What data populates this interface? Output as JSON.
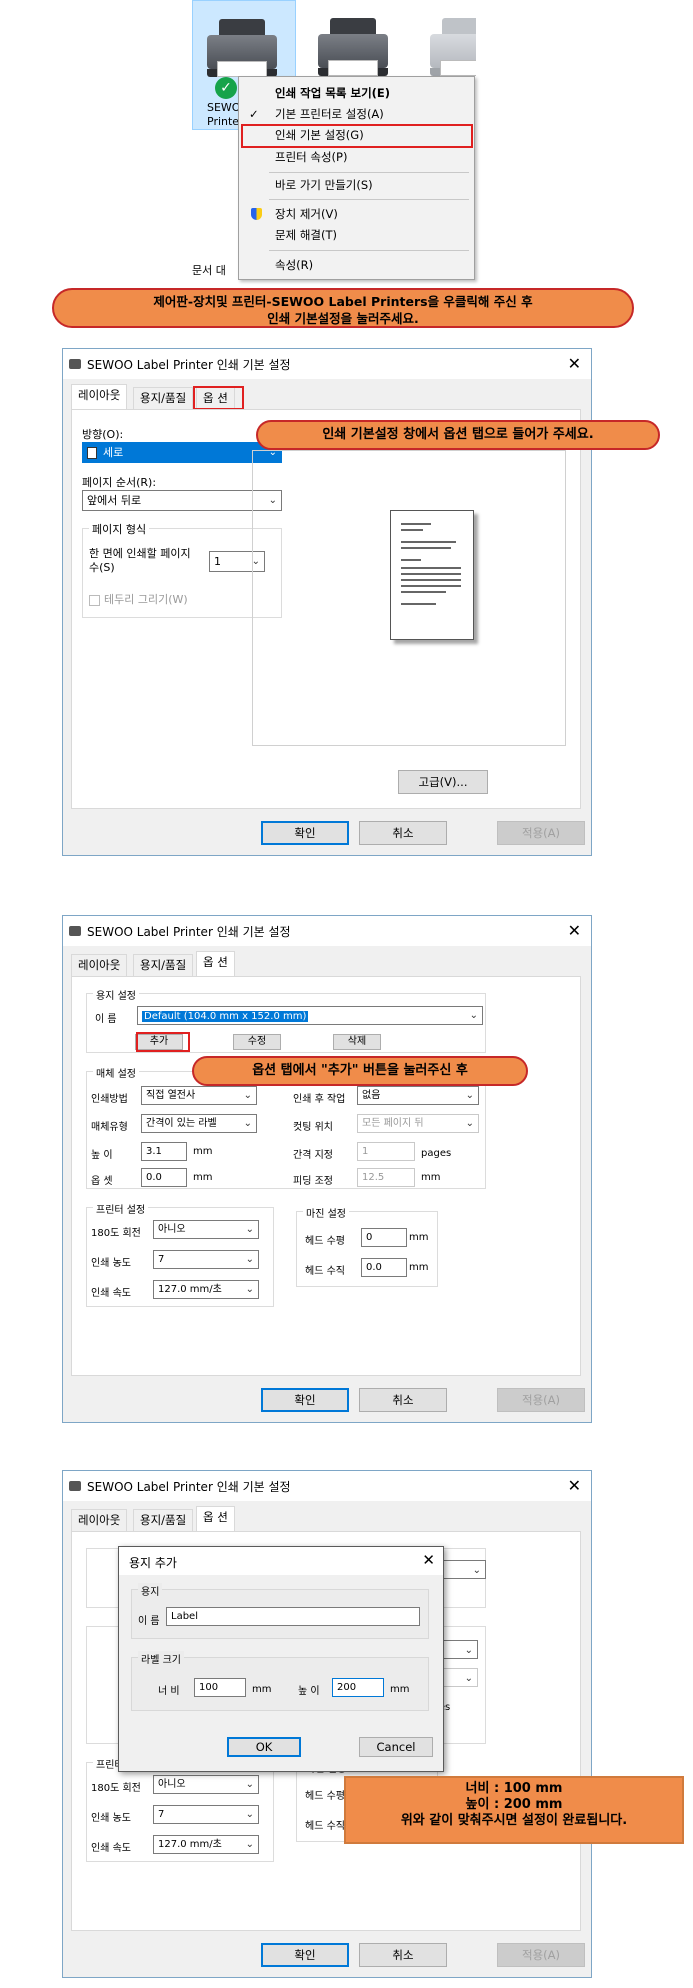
{
  "printers": [
    {
      "label": "SEWOO",
      "label2": "Printer"
    },
    {
      "label": ""
    },
    {
      "label": ""
    }
  ],
  "left_frag": "문서 대",
  "context_menu": [
    {
      "label": "인쇄 작업 목록 보기(E)",
      "bold": true
    },
    {
      "label": "기본 프린터로 설정(A)",
      "check": "✓"
    },
    {
      "label": "인쇄 기본 설정(G)"
    },
    {
      "label": "프린터 속성(P)"
    },
    {
      "label": "바로 가기 만들기(S)"
    },
    {
      "label": "장치 제거(V)"
    },
    {
      "label": "문제 해결(T)"
    },
    {
      "label": "속성(R)"
    }
  ],
  "callouts": {
    "c1": "제어판-장치및 프린터-SEWOO Label Printers을 우클릭해 주신 후",
    "c1b": "인쇄 기본설정을 눌러주세요.",
    "c2": "인쇄 기본설정 창에서 옵션 탭으로 들어가 주세요.",
    "c3": "옵션 탭에서 \"추가\" 버튼을 눌러주신 후",
    "c4a": "너비 : 100 mm",
    "c4b": "높이 : 200 mm",
    "c4c": "위와 같이 맞춰주시면 설정이 완료됩니다."
  },
  "dialog": {
    "title": "SEWOO Label Printer 인쇄 기본 설정",
    "tabs": [
      "레이아웃",
      "용지/품질",
      "옵 션"
    ],
    "ok": "확인",
    "cancel": "취소",
    "apply": "적용(A)"
  },
  "layout": {
    "orientation_label": "방향(O):",
    "orientation_value": "세로",
    "page_order_label": "페이지 순서(R):",
    "page_order_value": "앞에서 뒤로",
    "page_format_label": "페이지 형식",
    "pages_per_sheet_label": "한 면에 인쇄할 페이지 수(S)",
    "pages_per_sheet_value": "1",
    "draw_borders_label": "테두리 그리기(W)",
    "advanced": "고급(V)..."
  },
  "options": {
    "paper_group": "용지 설정",
    "name_label": "이 름",
    "name_value": "Default (104.0 mm x 152.0 mm)",
    "add": "추가",
    "edit": "수정",
    "delete": "삭제",
    "media_group": "매체 설정",
    "print_method_label": "인쇄방법",
    "print_method_value": "직접 열전사",
    "media_type_label": "매체유형",
    "media_type_value": "간격이 있는 라벨",
    "height_label": "높 이",
    "height_value": "3.1",
    "height_unit": "mm",
    "offset_label": "옵 셋",
    "offset_value": "0.0",
    "offset_unit": "mm",
    "post_print_label": "인쇄 후 작업",
    "post_print_value": "없음",
    "cut_pos_label": "컷팅 위치",
    "cut_pos_value": "모든 페이지 뒤",
    "interval_label": "간격 지정",
    "interval_value": "1",
    "interval_unit": "pages",
    "feed_label": "피딩 조정",
    "feed_value": "12.5",
    "feed_unit": "mm",
    "printer_group": "프린터 설정",
    "rotate_label": "180도 회전",
    "rotate_value": "아니오",
    "density_label": "인쇄 농도",
    "density_value": "7",
    "speed_label": "인쇄 속도",
    "speed_value": "127.0 mm/초",
    "margin_group": "마진 설정",
    "head_h_label": "헤드 수평",
    "head_h_value": "0",
    "head_h_unit": "mm",
    "head_v_label": "헤드 수직",
    "head_v_value": "0.0",
    "head_v_unit": "mm"
  },
  "add_paper": {
    "title": "용지 추가",
    "paper_group": "용지",
    "name_label": "이 름",
    "name_value": "Label",
    "size_group": "라벨 크기",
    "width_label": "너 비",
    "width_value": "100",
    "width_unit": "mm",
    "height_label": "높 이",
    "height_value": "200",
    "height_unit": "mm",
    "ok": "OK",
    "cancel": "Cancel",
    "trunc_pages": "pages"
  },
  "colors": {
    "callout": "#f08c4a",
    "callout_border": "#c62828",
    "highlight": "#e02020",
    "accent": "#0078d7"
  }
}
